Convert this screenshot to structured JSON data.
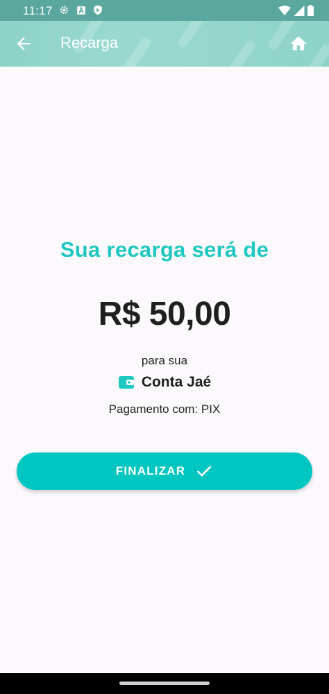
{
  "status_bar": {
    "time": "11:17",
    "icons": [
      "gear-icon",
      "a-box-icon",
      "shield-play-icon",
      "wifi-icon",
      "signal-icon",
      "battery-icon"
    ]
  },
  "app_bar": {
    "title": "Recarga",
    "back_icon": "arrow-left-icon",
    "home_icon": "home-icon"
  },
  "main": {
    "headline": "Sua recarga será de",
    "amount": "R$ 50,00",
    "para_sua": "para sua",
    "account_name": "Conta Jaé",
    "account_icon": "wallet-icon",
    "payment_method": "Pagamento com: PIX"
  },
  "finalize_button": {
    "label": "FINALIZAR",
    "icon": "check-icon"
  },
  "colors": {
    "accent": "#00c6c2",
    "headline": "#1ec8c0",
    "app_bar": "#8ed3c8",
    "status_bar": "#5aa79d"
  }
}
